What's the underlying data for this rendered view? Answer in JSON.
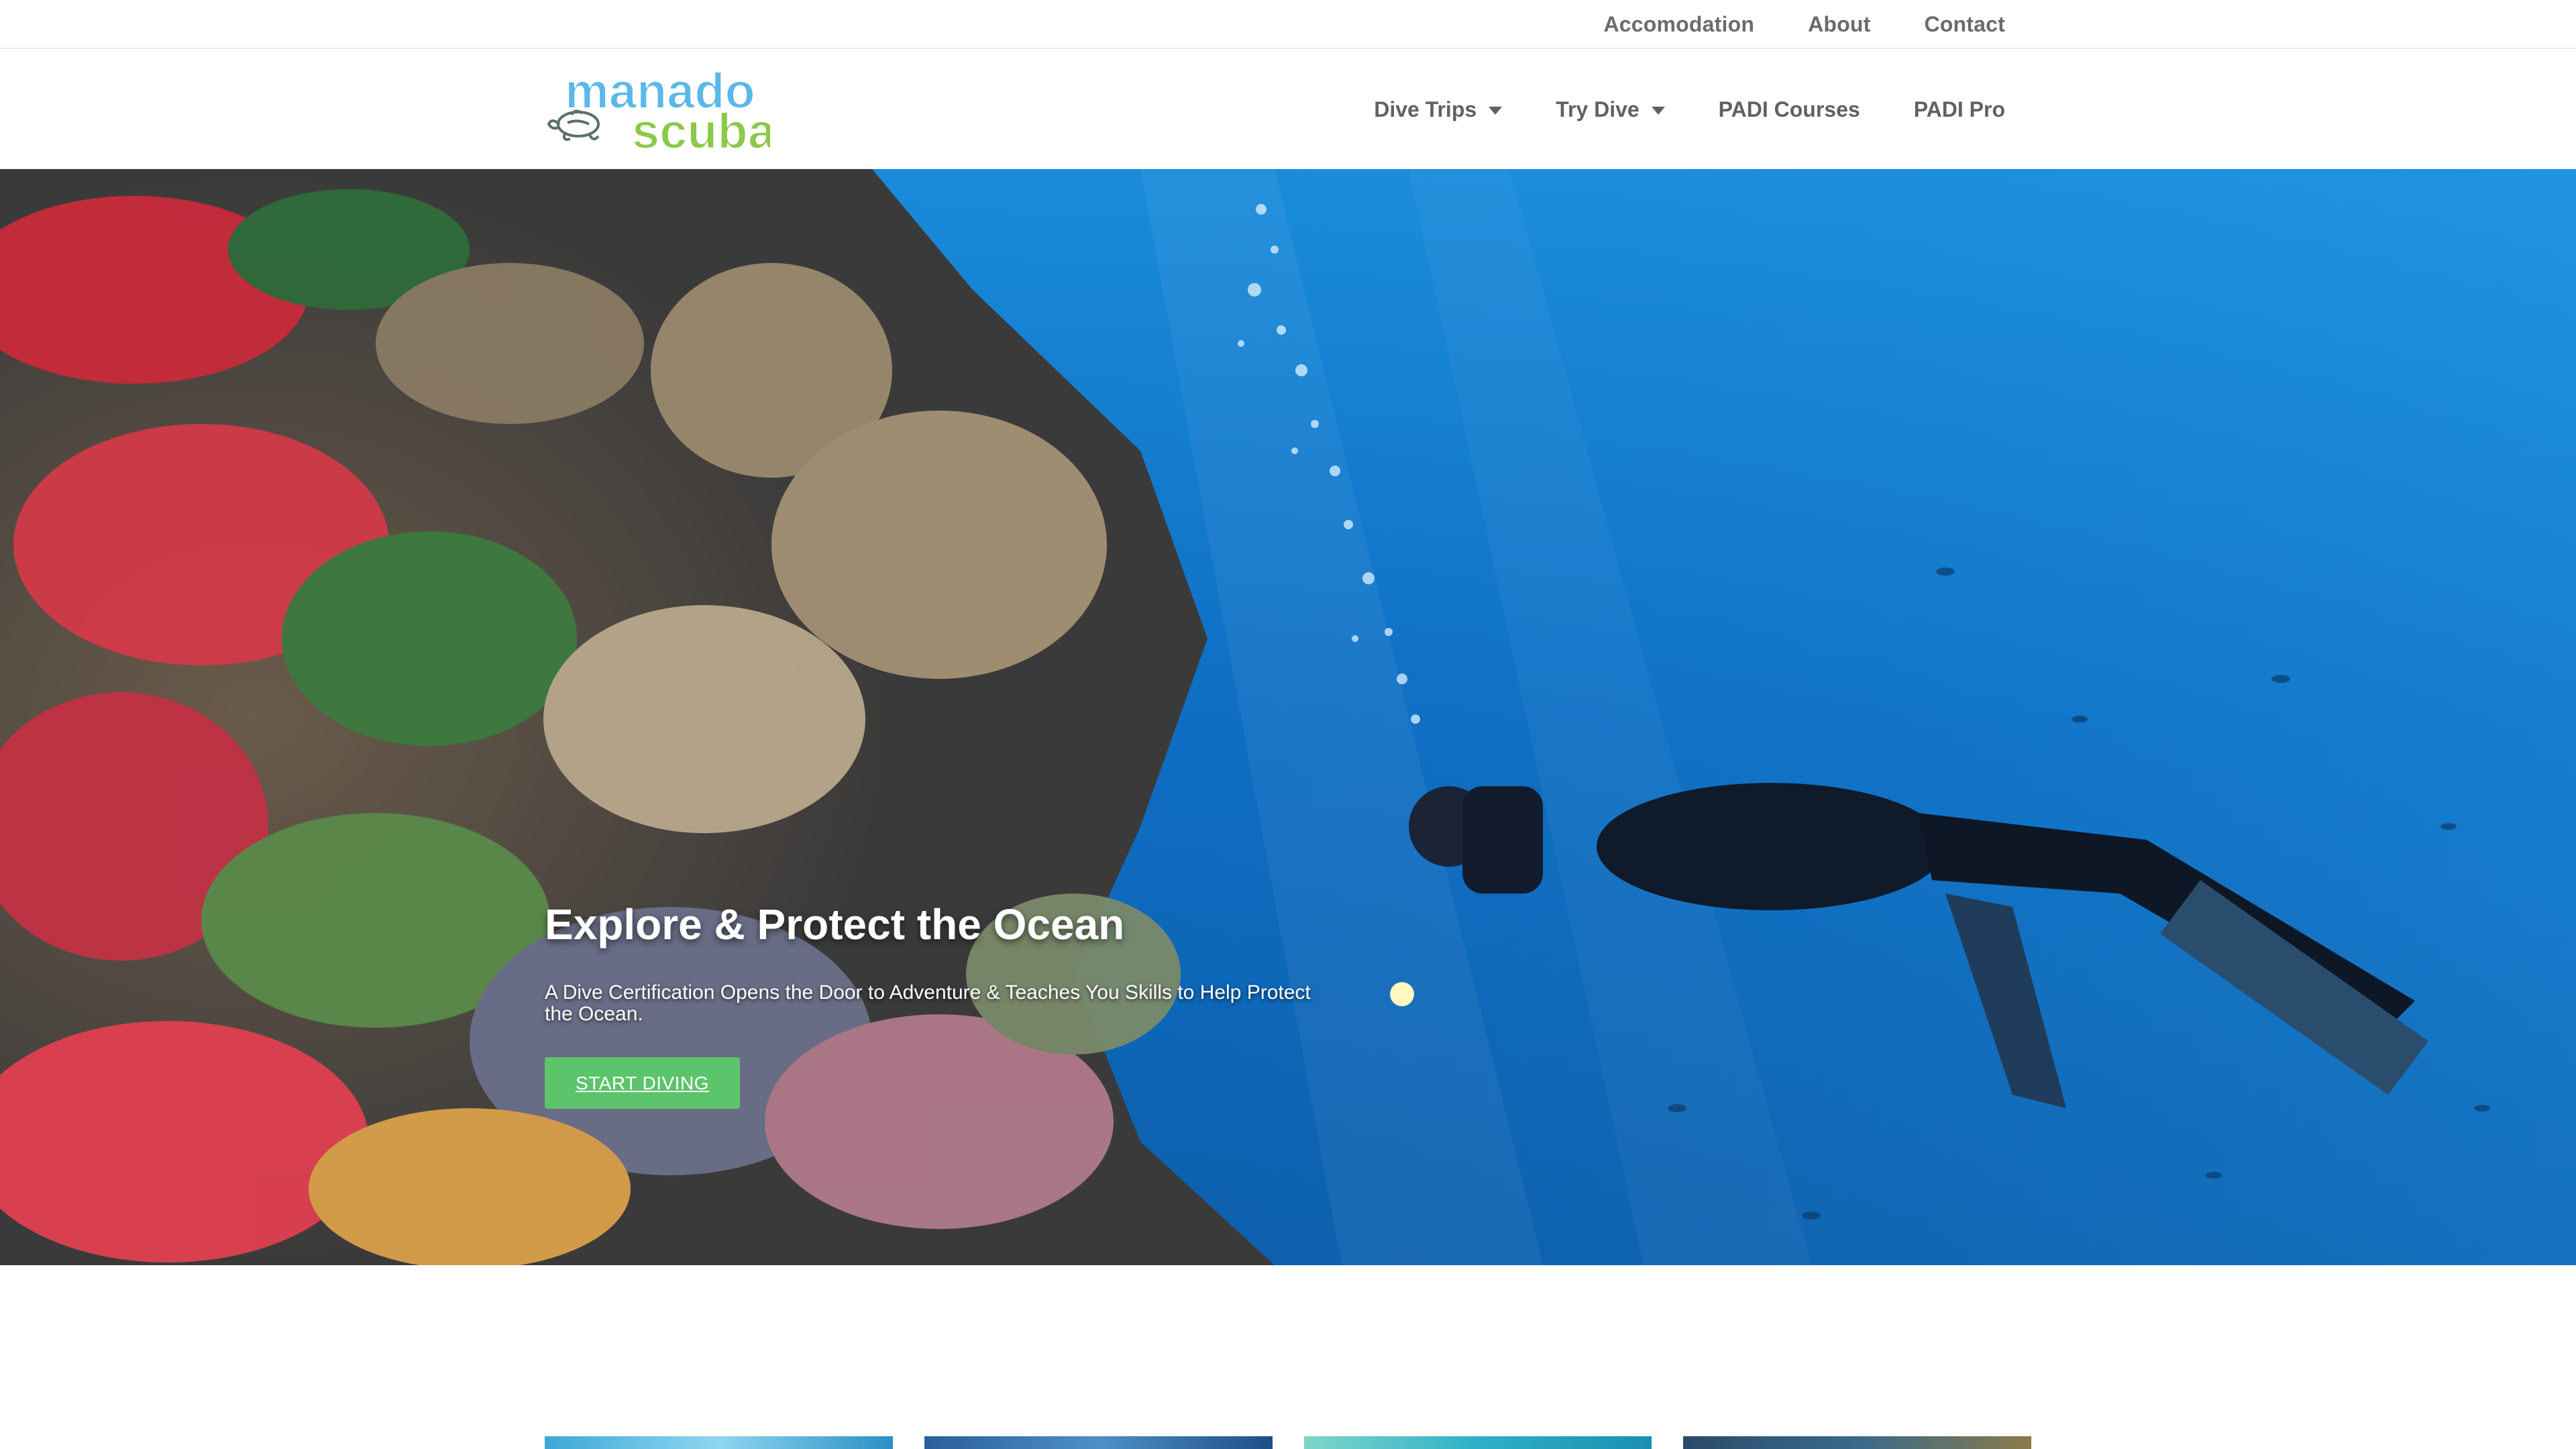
{
  "top_nav": [
    {
      "label": "Accomodation"
    },
    {
      "label": "About"
    },
    {
      "label": "Contact"
    }
  ],
  "logo": {
    "line1": "manado",
    "line2": "scuba",
    "color_top": "#5bb8e8",
    "color_bottom": "#8cc84b"
  },
  "main_nav": [
    {
      "label": "Dive Trips",
      "has_dropdown": true
    },
    {
      "label": "Try Dive",
      "has_dropdown": true
    },
    {
      "label": "PADI Courses",
      "has_dropdown": false
    },
    {
      "label": "PADI Pro",
      "has_dropdown": false
    }
  ],
  "hero": {
    "title": "Explore & Protect the Ocean",
    "subtitle": "A Dive Certification Opens the Door to Adventure & Teaches You Skills to Help Protect the Ocean.",
    "cta_label": "START DIVING"
  },
  "colors": {
    "accent": "#5cc46a",
    "ocean": "#0e6fc2",
    "nav_text": "#5e6166"
  },
  "icons": [
    "chevron-down-icon"
  ]
}
